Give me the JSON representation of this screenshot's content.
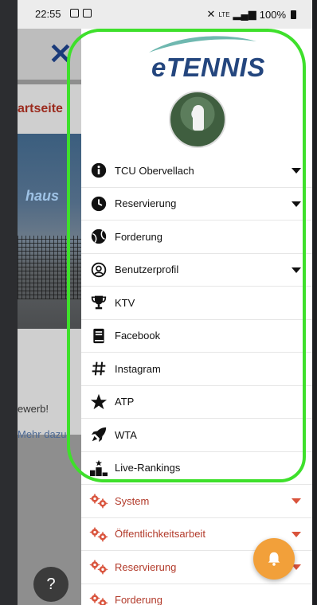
{
  "statusbar": {
    "time": "22:55",
    "battery": "100%",
    "network": "LTE"
  },
  "background": {
    "breadcrumb": "artseite",
    "sign_text": "haus",
    "text_line1": "ewerb!",
    "text_line2": "Mehr dazu"
  },
  "drawer": {
    "brand": "eTENNIS",
    "menu": [
      {
        "label": "TCU Obervellach",
        "icon": "info-icon",
        "caret": true
      },
      {
        "label": "Reservierung",
        "icon": "clock-icon",
        "caret": true
      },
      {
        "label": "Forderung",
        "icon": "tennis-ball-icon",
        "caret": false
      },
      {
        "label": "Benutzerprofil",
        "icon": "user-circle-icon",
        "caret": true
      },
      {
        "label": "KTV",
        "icon": "trophy-icon",
        "caret": false
      },
      {
        "label": "Facebook",
        "icon": "book-icon",
        "caret": false
      },
      {
        "label": "Instagram",
        "icon": "hashtag-icon",
        "caret": false
      },
      {
        "label": "ATP",
        "icon": "star-icon",
        "caret": false
      },
      {
        "label": "WTA",
        "icon": "rocket-icon",
        "caret": false
      },
      {
        "label": "Live-Rankings",
        "icon": "podium-icon",
        "caret": false
      }
    ],
    "admin_menu": [
      {
        "label": "System",
        "icon": "gears-icon",
        "caret": true
      },
      {
        "label": "Öffentlichkeitsarbeit",
        "icon": "gears-icon",
        "caret": true
      },
      {
        "label": "Reservierung",
        "icon": "gears-icon",
        "caret": true
      },
      {
        "label": "Forderung",
        "icon": "gears-icon",
        "caret": false
      }
    ]
  },
  "colors": {
    "brand": "#24467e",
    "admin_red": "#b23a2a",
    "highlight": "#3ee02b",
    "fab": "#f2a03a"
  }
}
